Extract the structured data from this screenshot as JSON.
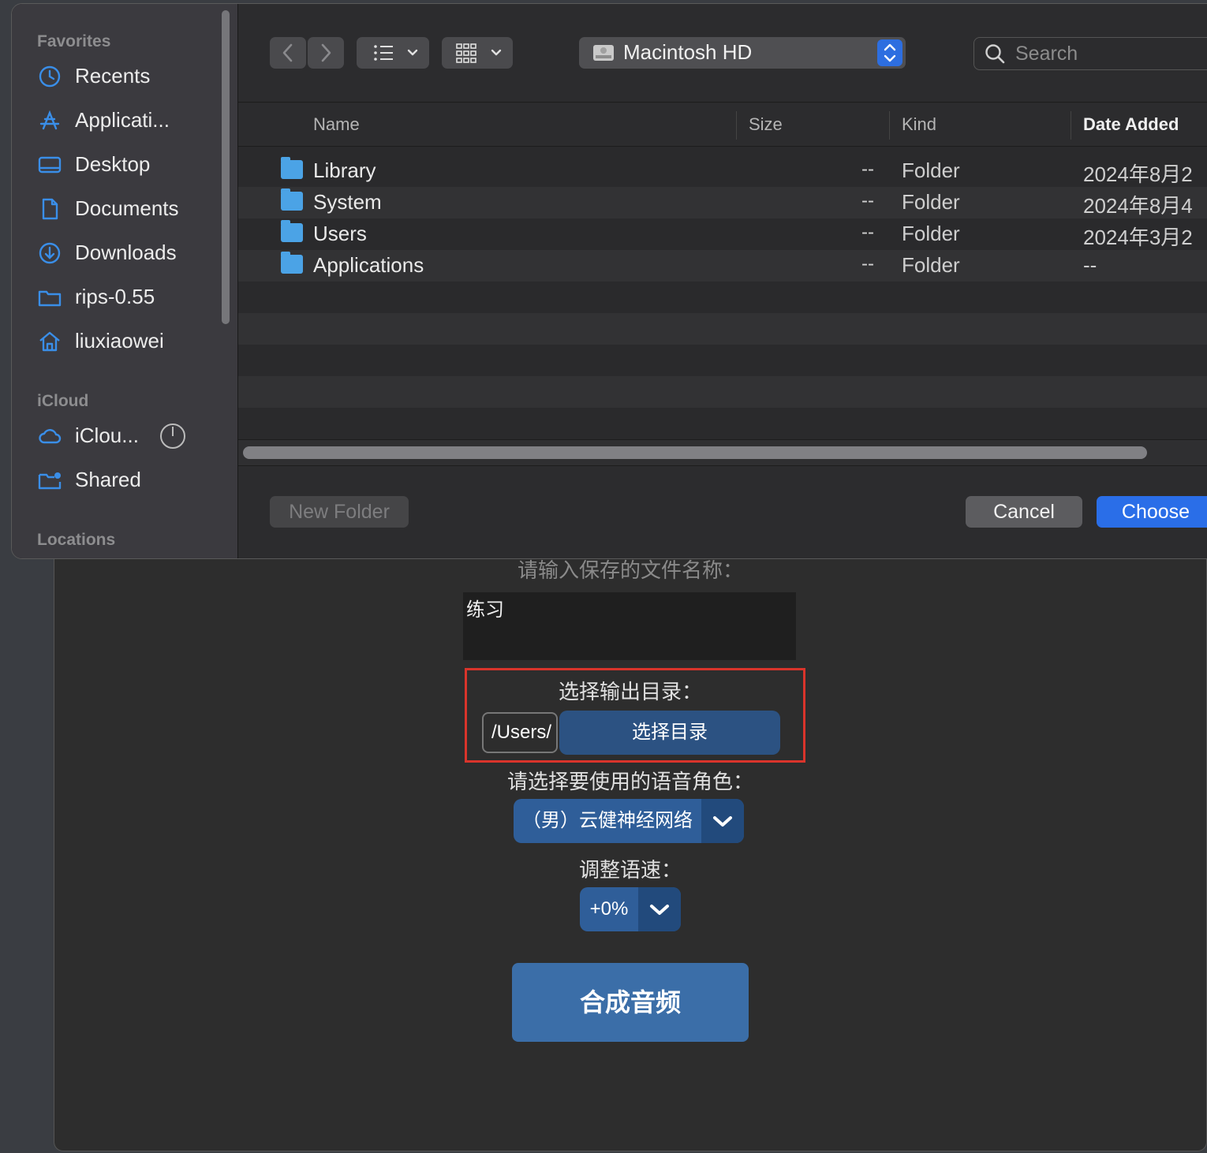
{
  "dialog": {
    "sidebar": {
      "sections": {
        "favorites": "Favorites",
        "icloud": "iCloud",
        "locations": "Locations"
      },
      "favorites": [
        {
          "label": "Recents",
          "icon": "clock-icon"
        },
        {
          "label": "Applicati...",
          "icon": "applications-icon"
        },
        {
          "label": "Desktop",
          "icon": "desktop-icon"
        },
        {
          "label": "Documents",
          "icon": "document-icon"
        },
        {
          "label": "Downloads",
          "icon": "download-icon"
        },
        {
          "label": "rips-0.55",
          "icon": "folder-icon"
        },
        {
          "label": "liuxiaowei",
          "icon": "home-icon"
        }
      ],
      "icloud": [
        {
          "label": "iClou...",
          "icon": "cloud-icon"
        },
        {
          "label": "Shared",
          "icon": "shared-folder-icon"
        }
      ]
    },
    "toolbar": {
      "volume": "Macintosh HD",
      "search_placeholder": "Search"
    },
    "columns": {
      "name": "Name",
      "size": "Size",
      "kind": "Kind",
      "date_added": "Date Added"
    },
    "files": [
      {
        "name": "Library",
        "size": "--",
        "kind": "Folder",
        "date": "2024年8月2"
      },
      {
        "name": "System",
        "size": "--",
        "kind": "Folder",
        "date": "2024年8月4"
      },
      {
        "name": "Users",
        "size": "--",
        "kind": "Folder",
        "date": "2024年3月2"
      },
      {
        "name": "Applications",
        "size": "--",
        "kind": "Folder",
        "date": "--"
      }
    ],
    "buttons": {
      "new_folder": "New Folder",
      "cancel": "Cancel",
      "choose": "Choose"
    }
  },
  "app": {
    "filename_label": "请输入保存的文件名称：",
    "filename_value": "练习",
    "output_dir_label": "选择输出目录：",
    "output_dir_value": "/Users/",
    "choose_dir_button": "选择目录",
    "voice_label": "请选择要使用的语音角色：",
    "voice_value": "（男）云健神经网络",
    "speed_label": "调整语速：",
    "speed_value": "+0%",
    "synthesize_button": "合成音频"
  },
  "colors": {
    "accent": "#2a6ee8",
    "folder": "#4ba3e6",
    "highlight": "#d9342b",
    "app_button": "#3b6ea8"
  }
}
